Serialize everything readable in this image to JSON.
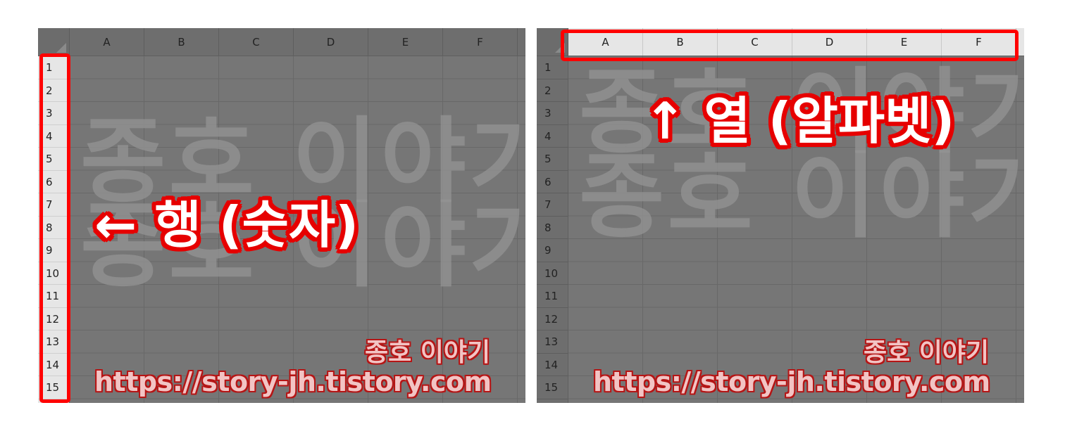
{
  "columns": [
    "A",
    "B",
    "C",
    "D",
    "E",
    "F"
  ],
  "rows": [
    "1",
    "2",
    "3",
    "4",
    "5",
    "6",
    "7",
    "8",
    "9",
    "10",
    "11",
    "12",
    "13",
    "14",
    "15"
  ],
  "watermark": {
    "line1": "종호",
    "line2": "이야기",
    "name": "종호 이야기",
    "url": "https://story-jh.tistory.com"
  },
  "left_panel": {
    "callout": "← 행 (숫자)"
  },
  "right_panel": {
    "callout": "↑ 열 (알파벳)"
  },
  "colors": {
    "highlight": "#ff0000",
    "dim_overlay": "#767676",
    "header_highlight": "#e6e6e6"
  }
}
